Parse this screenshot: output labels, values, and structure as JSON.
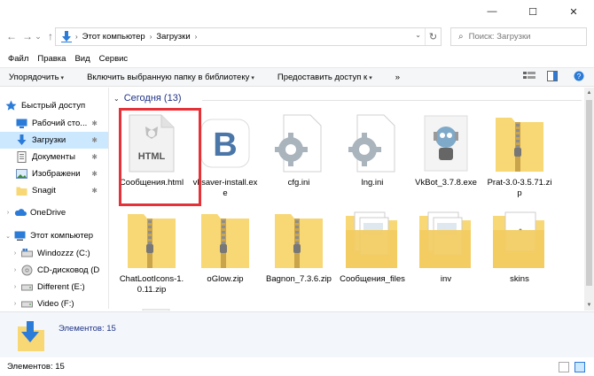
{
  "window": {
    "minimize_glyph": "—",
    "maximize_glyph": "☐",
    "close_glyph": "✕"
  },
  "address": {
    "back_glyph": "←",
    "forward_glyph": "→",
    "recent_glyph": "⌄",
    "up_glyph": "↑",
    "breadcrumb": [
      "Этот компьютер",
      "Загрузки"
    ],
    "separator": "›",
    "dropdown_glyph": "⌄",
    "refresh_glyph": "↻"
  },
  "search": {
    "placeholder": "Поиск: Загрузки",
    "icon_glyph": "⌕"
  },
  "menu": [
    "Файл",
    "Правка",
    "Вид",
    "Сервис"
  ],
  "commands": [
    {
      "label": "Упорядочить",
      "arrow": "▾"
    },
    {
      "label": "Включить выбранную папку в библиотеку",
      "arrow": "▾"
    },
    {
      "label": "Предоставить доступ к",
      "arrow": "▾"
    }
  ],
  "commands_more": "»",
  "nav": {
    "quick_access": "Быстрый доступ",
    "quick_items": [
      {
        "label": "Рабочий сто..."
      },
      {
        "label": "Загрузки"
      },
      {
        "label": "Документы"
      },
      {
        "label": "Изображени"
      },
      {
        "label": "Snagit"
      }
    ],
    "onedrive": "OneDrive",
    "this_pc": "Этот компьютер",
    "drives": [
      {
        "label": "Windozzz (C:)"
      },
      {
        "label": "CD-дисковод (D"
      },
      {
        "label": "Different (E:)"
      },
      {
        "label": "Video (F:)"
      }
    ],
    "pin_glyph": "📌"
  },
  "group": {
    "title": "Сегодня (13)",
    "chevron": "⌄"
  },
  "files_row1": [
    {
      "name": "Сообщения.html",
      "type": "html",
      "badge": "HTML"
    },
    {
      "name": "vksaver-install.exe",
      "type": "vk",
      "badge": "B"
    },
    {
      "name": "cfg.ini",
      "type": "ini"
    },
    {
      "name": "lng.ini",
      "type": "ini"
    },
    {
      "name": "VkBot_3.7.8.exe",
      "type": "bot"
    },
    {
      "name": "Prat-3.0-3.5.71.zip",
      "type": "zip"
    }
  ],
  "files_row2": [
    {
      "name": "ChatLootIcons-1.0.11.zip",
      "type": "zip"
    },
    {
      "name": "oGlow.zip",
      "type": "zip"
    },
    {
      "name": "Bagnon_7.3.6.zip",
      "type": "zip"
    },
    {
      "name": "Сообщения_files",
      "type": "folder-docs"
    },
    {
      "name": "inv",
      "type": "folder-docs"
    },
    {
      "name": "skins",
      "type": "folder-doc"
    }
  ],
  "details": {
    "count": "Элементов: 15"
  },
  "status": {
    "count": "Элементов: 15"
  },
  "colors": {
    "accent": "#1e3287",
    "selection": "#cce8ff",
    "highlight": "#e53238",
    "folder": "#f8d775",
    "vk": "#4a76a8"
  }
}
